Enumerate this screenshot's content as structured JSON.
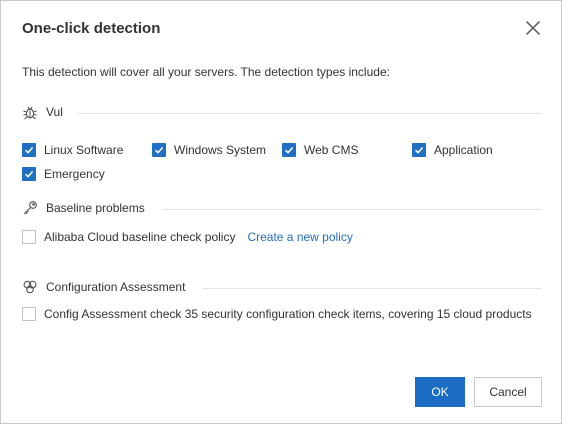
{
  "dialog": {
    "title": "One-click detection",
    "intro": "This detection will cover all your servers. The detection types include:"
  },
  "sections": {
    "vul": {
      "label": "Vul",
      "icon": "bug-icon",
      "items": [
        {
          "label": "Linux Software",
          "checked": true
        },
        {
          "label": "Windows System",
          "checked": true
        },
        {
          "label": "Web CMS",
          "checked": true
        },
        {
          "label": "Application",
          "checked": true
        },
        {
          "label": "Emergency",
          "checked": true
        }
      ]
    },
    "baseline": {
      "label": "Baseline problems",
      "icon": "key-icon",
      "item": {
        "label": "Alibaba Cloud baseline check policy",
        "checked": false
      },
      "link": "Create a new policy"
    },
    "config": {
      "label": "Configuration Assessment",
      "icon": "circles-icon",
      "item": {
        "label": "Config Assessment check 35 security configuration check items, covering 15 cloud products",
        "checked": false
      }
    }
  },
  "buttons": {
    "ok": "OK",
    "cancel": "Cancel"
  },
  "colors": {
    "primary": "#1f6fc5",
    "text": "#333333",
    "divider": "#e3e3e3"
  }
}
